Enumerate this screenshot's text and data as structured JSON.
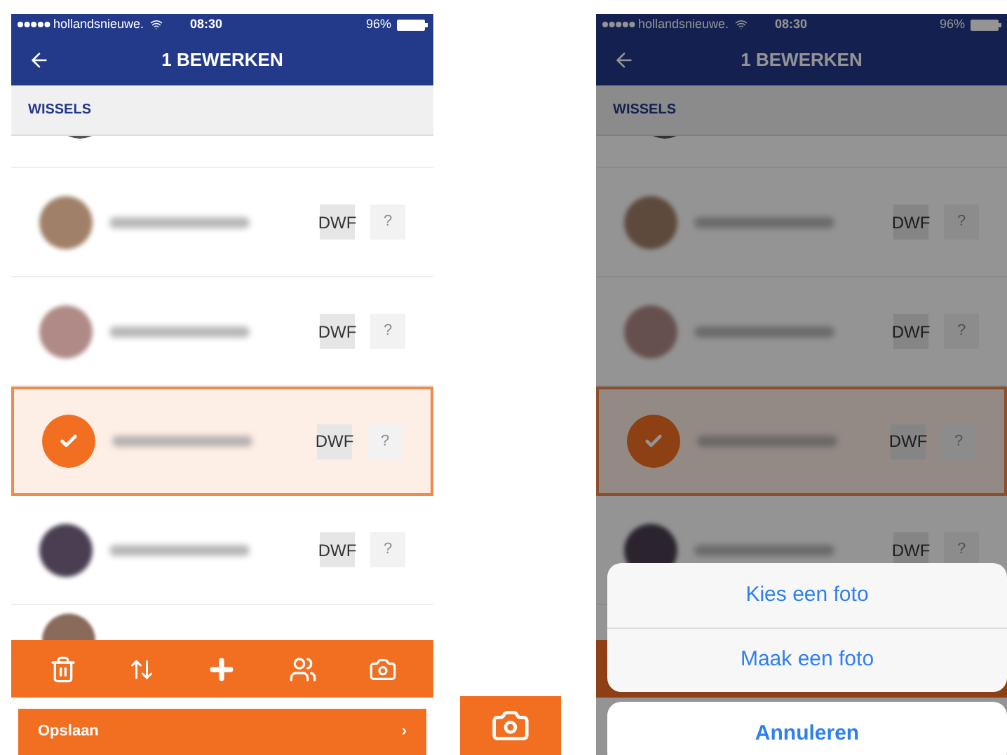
{
  "screens": [
    {
      "status": {
        "carrier": "hollandsnieuwe.",
        "time": "08:30",
        "battery": "96%"
      },
      "title": "1 BEWERKEN",
      "section": "WISSELS",
      "rows": [
        {
          "badge": "DWF",
          "extra": "?",
          "selected": false
        },
        {
          "badge": "DWF",
          "extra": "?",
          "selected": false
        },
        {
          "badge": "DWF",
          "extra": "?",
          "selected": true
        },
        {
          "badge": "DWF",
          "extra": "?",
          "selected": false
        }
      ],
      "save_button": "Opslaan",
      "chevron": "›"
    },
    {
      "status": {
        "carrier": "hollandsnieuwe.",
        "time": "08:30",
        "battery": "96%"
      },
      "title": "1 BEWERKEN",
      "section": "WISSELS",
      "rows": [
        {
          "badge": "DWF",
          "extra": "?",
          "selected": false
        },
        {
          "badge": "DWF",
          "extra": "?",
          "selected": false
        },
        {
          "badge": "DWF",
          "extra": "?",
          "selected": true
        },
        {
          "badge": "DWF",
          "extra": "?",
          "selected": false
        }
      ],
      "action_sheet": {
        "options": [
          "Kies een foto",
          "Maak een foto"
        ],
        "cancel": "Annuleren"
      }
    }
  ]
}
